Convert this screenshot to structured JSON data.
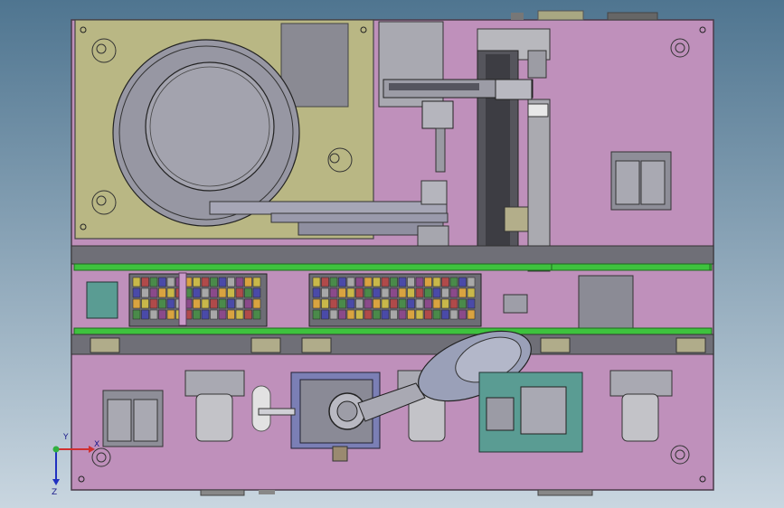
{
  "viewport": {
    "background_top": "#4f7590",
    "background_bottom": "#c9d6e0"
  },
  "colors": {
    "plate": "#bf90bb",
    "plate_edge": "#4a3a4a",
    "feeder_panel": "#b9b784",
    "conveyor_green": "#3ec23e",
    "rail_gray": "#8c8c94",
    "robot_body": "#9aa0b8",
    "module_blue": "#7b7fb5",
    "board_teal": "#5a9c93"
  },
  "icons": {
    "axis_triad": "axis-triad-icon"
  },
  "triad": {
    "x_label": "X",
    "y_label": "Y",
    "z_label": "Z"
  }
}
